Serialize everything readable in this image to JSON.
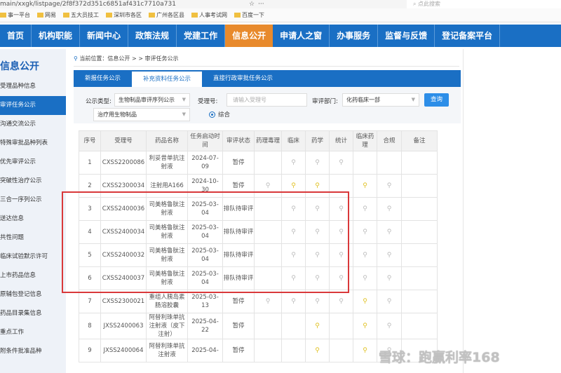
{
  "browser": {
    "url": "main/xxgk/listpage/2f8f372d351c6851af431c7710a731",
    "search_placeholder": "点此搜索",
    "bookmarks": [
      "事一平台",
      "网易",
      "五大员技工",
      "深圳市各区",
      "广州各区县",
      "人事考试网",
      "百度一下"
    ]
  },
  "nav": [
    "首页",
    "机构职能",
    "新闻中心",
    "政策法规",
    "党建工作",
    "信息公开",
    "申请人之窗",
    "办事服务",
    "监督与反馈",
    "登记备案平台"
  ],
  "sidebar": {
    "title": "信息公开",
    "items": [
      "受理品种信息",
      "审评任务公示",
      "沟通交流公示",
      "特殊审批品种列表",
      "优先审评公示",
      "突破性治疗公示",
      "三合一序列公示",
      "送达信息",
      "共性问题",
      "临床试验默示许可",
      "上市药品信息",
      "原辅包登记信息",
      "药品目录集信息",
      "重点工作",
      "附条件批准品种"
    ]
  },
  "breadcrumb": {
    "label": "当前位置：信息公开 > > 审评任务公示"
  },
  "tabs": [
    "新报任务公示",
    "补充资料任务公示",
    "直接行政审批任务公示"
  ],
  "filter": {
    "type_label": "公示类型:",
    "type_value": "生物制品审评序列公示",
    "sub_value": "治疗用生物制品",
    "accept_label": "受理号:",
    "accept_placeholder": "请输入受理号",
    "dept_label": "审评部门:",
    "dept_value": "化药临床一部",
    "query": "查询",
    "radio": "综合"
  },
  "table": {
    "headers": [
      "序号",
      "受理号",
      "药品名称",
      "任务启动时间",
      "审评状态",
      "药理毒理",
      "临床",
      "药学",
      "统计",
      "临床药理",
      "合规",
      "备注"
    ],
    "rows": [
      {
        "no": "1",
        "id": "CXSS2200086",
        "name": "利妥昔单抗注射液",
        "date": "2024-07-09",
        "status": "暂停",
        "b": [
          "",
          "g",
          "g",
          "g",
          "",
          ""
        ]
      },
      {
        "no": "2",
        "id": "CXSS2300034",
        "name": "注射用A166",
        "date": "2024-10-30",
        "status": "暂停",
        "b": [
          "g",
          "y",
          "y",
          "",
          "y",
          "g"
        ]
      },
      {
        "no": "3",
        "id": "CXSS2400036",
        "name": "司美格鲁肽注射液",
        "date": "2025-03-04",
        "status": "排队待审评",
        "b": [
          "",
          "g",
          "g",
          "g",
          "g",
          "g"
        ]
      },
      {
        "no": "4",
        "id": "CXSS2400034",
        "name": "司美格鲁肽注射液",
        "date": "2025-03-04",
        "status": "排队待审评",
        "b": [
          "",
          "g",
          "g",
          "g",
          "g",
          "g"
        ]
      },
      {
        "no": "5",
        "id": "CXSS2400032",
        "name": "司美格鲁肽注射液",
        "date": "2025-03-04",
        "status": "排队待审评",
        "b": [
          "",
          "g",
          "g",
          "g",
          "g",
          "g"
        ]
      },
      {
        "no": "6",
        "id": "CXSS2400037",
        "name": "司美格鲁肽注射液",
        "date": "2025-03-04",
        "status": "排队待审评",
        "b": [
          "",
          "g",
          "g",
          "g",
          "g",
          "g"
        ]
      },
      {
        "no": "7",
        "id": "CXSS2300021",
        "name": "重组人胰岛素肠溶胶囊",
        "date": "2025-03-13",
        "status": "暂停",
        "b": [
          "g",
          "g",
          "g",
          "g",
          "y",
          "g"
        ]
      },
      {
        "no": "8",
        "id": "JXSS2400063",
        "name": "阿替利珠单抗注射液（皮下注射）",
        "date": "2025-04-22",
        "status": "暂停",
        "b": [
          "",
          "",
          "y",
          "",
          "y",
          "g"
        ]
      },
      {
        "no": "9",
        "id": "JXSS2400064",
        "name": "阿替利珠单抗注射液",
        "date": "2025-04-",
        "status": "暂停",
        "b": [
          "",
          "",
          "y",
          "",
          "y",
          "g"
        ]
      }
    ]
  },
  "watermark": "雪球：跑赢利率168",
  "colors": {
    "nav": "#1a6fc4",
    "active_nav": "#e88a2c",
    "highlight": "#d9383a",
    "bulb_on": "#e0c020",
    "bulb_off": "#bbbbbb"
  }
}
